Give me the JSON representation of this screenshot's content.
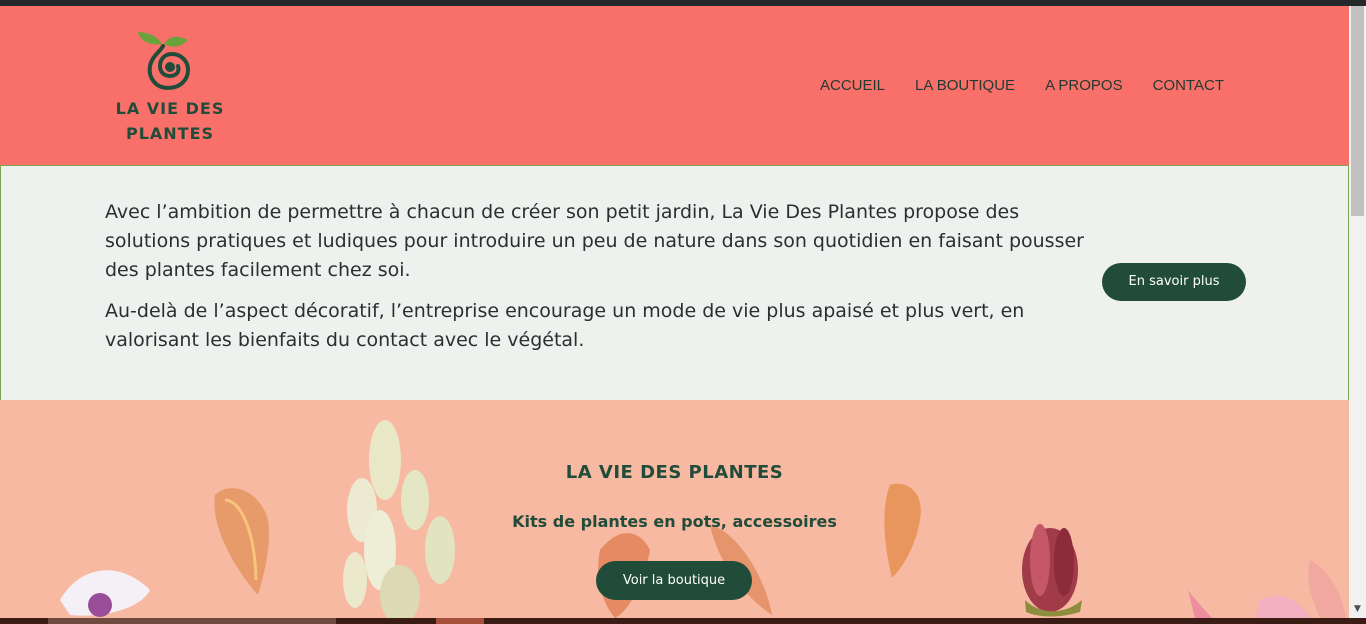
{
  "logo": {
    "line1": "LA VIE DES",
    "line2": "PLANTES",
    "icon": "sprout-swirl-icon"
  },
  "nav": {
    "items": [
      "ACCUEIL",
      "LA BOUTIQUE",
      "A PROPOS",
      "CONTACT"
    ]
  },
  "about": {
    "paragraph1": "Avec l’ambition de permettre à chacun de créer son petit jardin, La Vie Des Plantes propose des solutions pratiques et ludiques pour introduire un peu de nature dans son quotidien en faisant pousser des plantes facilement chez soi.",
    "paragraph2": "Au-delà de l’aspect décoratif, l’entreprise encourage un mode de vie plus apaisé et plus vert, en valorisant les bienfaits du contact avec le végétal.",
    "button": "En savoir plus"
  },
  "hero": {
    "title": "LA VIE DES PLANTES",
    "subtitle": "Kits de plantes en pots, accessoires",
    "button": "Voir la boutique"
  },
  "colors": {
    "header": "#f9706a",
    "brand_green": "#214c3a",
    "about_bg": "#eef1ed",
    "hero_bg": "#f7b9a1"
  }
}
